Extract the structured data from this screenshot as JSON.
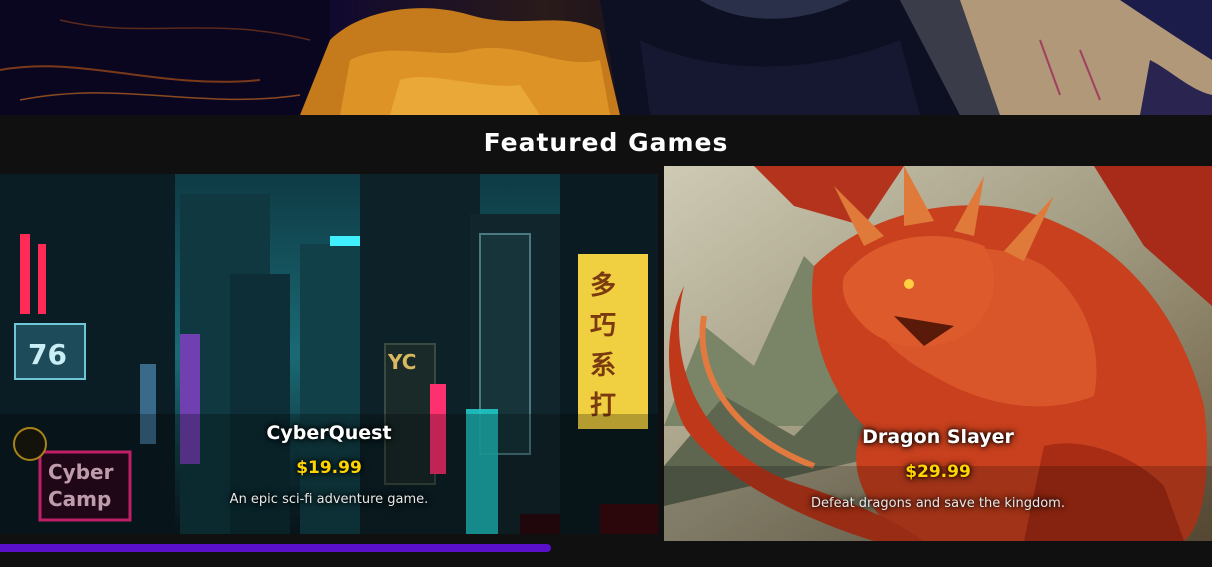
{
  "section": {
    "title": "Featured Games"
  },
  "games": [
    {
      "title": "CyberQuest",
      "price": "$19.99",
      "description": "An epic sci-fi adventure game.",
      "art_icon": "cyberpunk-city-image"
    },
    {
      "title": "Dragon Slayer",
      "price": "$29.99",
      "description": "Defeat dragons and save the kingdom.",
      "art_icon": "red-dragon-image"
    }
  ],
  "carousel": {
    "progress": 0.455
  },
  "colors": {
    "background": "#101010",
    "price": "#ffd400",
    "progress": "#5a0fc8",
    "title": "#ffffff"
  }
}
